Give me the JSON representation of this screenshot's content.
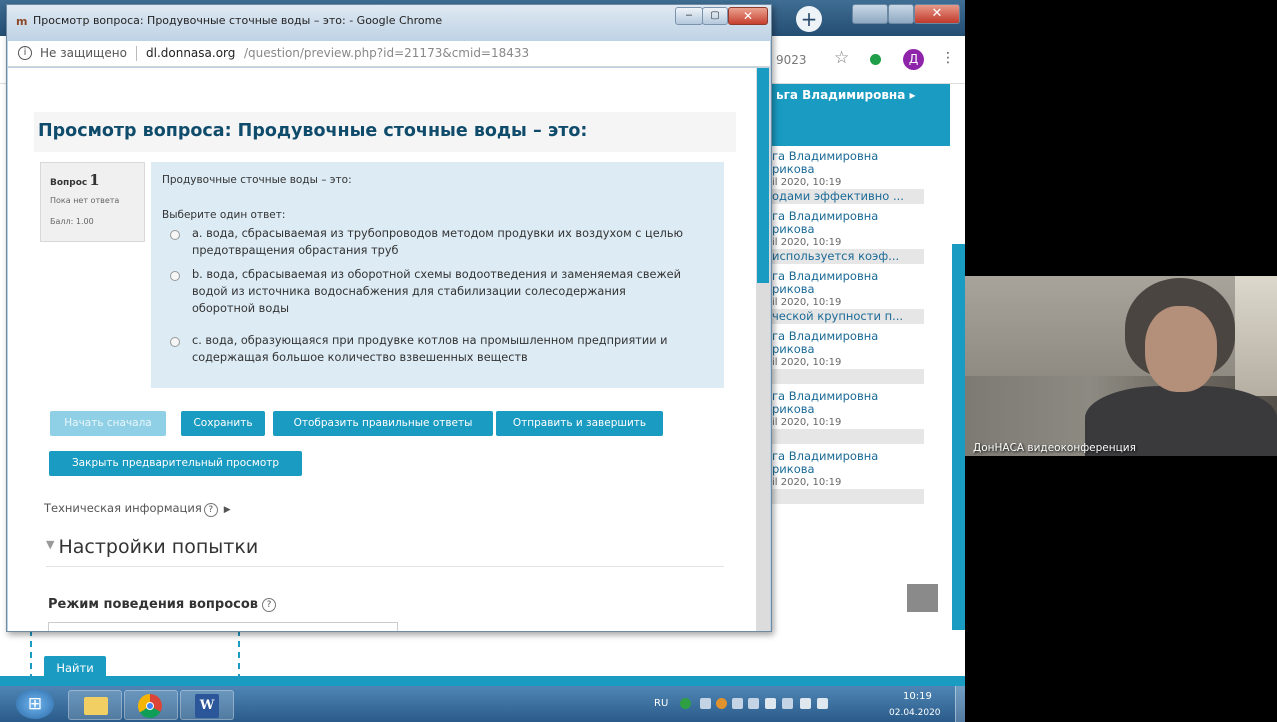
{
  "background_browser": {
    "new_tab_label": "+",
    "address_fragment": "9023",
    "avatar_letter": "Д",
    "username": "ьга Владимировна ▸",
    "sidebar_entries": [
      {
        "name": "га Владимировна",
        "name2": "рикова",
        "date": "il 2020, 10:19",
        "strip": "одами эффективно ..."
      },
      {
        "name": "га Владимировна",
        "name2": "рикова",
        "date": "il 2020, 10:19",
        "strip": "используется коэф..."
      },
      {
        "name": "га Владимировна",
        "name2": "рикова",
        "date": "il 2020, 10:19",
        "strip": "ческой крупности п..."
      },
      {
        "name": "га Владимировна",
        "name2": "рикова",
        "date": "il 2020, 10:19",
        "strip": ""
      },
      {
        "name": "га Владимировна",
        "name2": "рикова",
        "date": "il 2020, 10:19",
        "strip": ""
      },
      {
        "name": "га Владимировна",
        "name2": "рикова",
        "date": "il 2020, 10:19",
        "strip": ""
      }
    ],
    "find_button": "Найти"
  },
  "popup": {
    "favicon": "m",
    "window_title": "Просмотр вопроса: Продувочные сточные воды – это: - Google Chrome",
    "minimize_glyph": "‒",
    "maximize_glyph": "▢",
    "close_glyph": "✕",
    "info_glyph": "i",
    "not_secure_label": "Не защищено",
    "url_host": "dl.donnasa.org",
    "url_path": "/question/preview.php?id=21173&cmid=18433"
  },
  "page": {
    "heading": "Просмотр вопроса: Продувочные сточные воды – это:",
    "question_info": {
      "label": "Вопрос",
      "number": "1",
      "state": "Пока нет ответа",
      "grade": "Балл: 1.00"
    },
    "question_text": "Продувочные сточные воды – это:",
    "prompt": "Выберите один ответ:",
    "options": [
      {
        "text": "a. вода, сбрасываемая из трубопроводов методом продувки их воздухом с целью предотвращения обрастания труб"
      },
      {
        "text": "b. вода, сбрасываемая из оборотной схемы водоотведения и заменяемая свежей водой из источника водоснабжения для стабилизации солесодержания оборотной воды"
      },
      {
        "text": "c. вода, образующаяся при продувке котлов на промышленном предприятии и содержащая большое количество взвешенных веществ"
      }
    ],
    "buttons": {
      "restart": "Начать сначала",
      "save": "Сохранить",
      "fill_correct": "Отобразить правильные ответы",
      "submit_finish": "Отправить и завершить",
      "close_preview": "Закрыть предварительный просмотр"
    },
    "technical_info": "Техническая информация",
    "help_glyph": "?",
    "settings_heading": "Настройки попытки",
    "behaviour_label": "Режим поведения вопросов"
  },
  "taskbar": {
    "language": "RU",
    "time": "10:19",
    "date": "02.04.2020",
    "start_glyph": "⊞",
    "word_glyph": "W"
  },
  "video": {
    "label": "ДонНАСА видеоконференция"
  }
}
